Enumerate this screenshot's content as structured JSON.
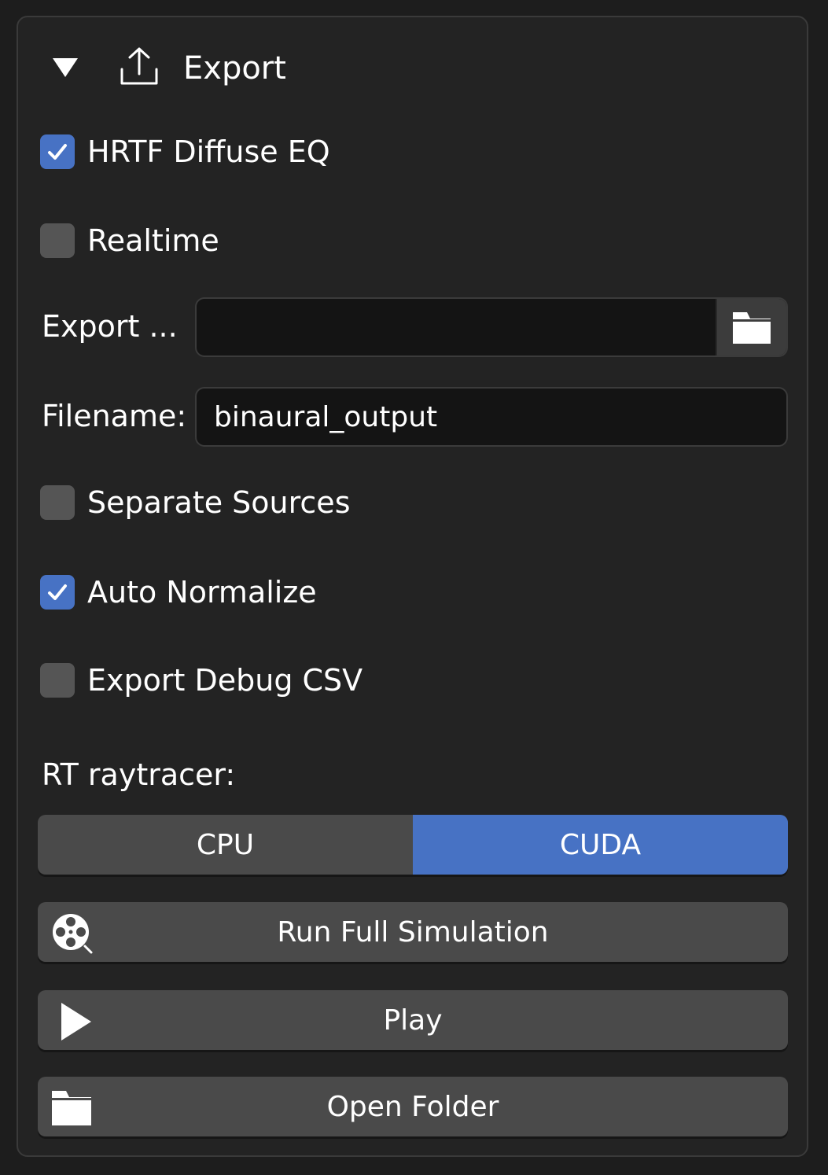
{
  "header": {
    "title": "Export"
  },
  "options": {
    "hrtf_diffuse_eq": {
      "label": "HRTF Diffuse EQ",
      "checked": true
    },
    "realtime": {
      "label": "Realtime",
      "checked": false
    },
    "separate_sources": {
      "label": "Separate Sources",
      "checked": false
    },
    "auto_normalize": {
      "label": "Auto Normalize",
      "checked": true
    },
    "export_debug_csv": {
      "label": "Export Debug CSV",
      "checked": false
    }
  },
  "export_path": {
    "label": "Export ...",
    "value": ""
  },
  "filename": {
    "label": "Filename:",
    "value": "binaural_output"
  },
  "raytracer": {
    "label": "RT raytracer:",
    "options": [
      "CPU",
      "CUDA"
    ],
    "selected": "CUDA"
  },
  "actions": {
    "run_full_simulation": "Run Full Simulation",
    "play": "Play",
    "open_folder": "Open Folder"
  },
  "icons": {
    "collapse": "triangle-down-icon",
    "export": "upload-icon",
    "browse": "folder-icon",
    "simulation": "film-reel-icon",
    "play": "play-icon",
    "open_folder": "folder-icon"
  },
  "colors": {
    "accent": "#4772c4",
    "panel_bg": "#232323",
    "button_bg": "#4a4a4a",
    "input_bg": "#141414"
  }
}
